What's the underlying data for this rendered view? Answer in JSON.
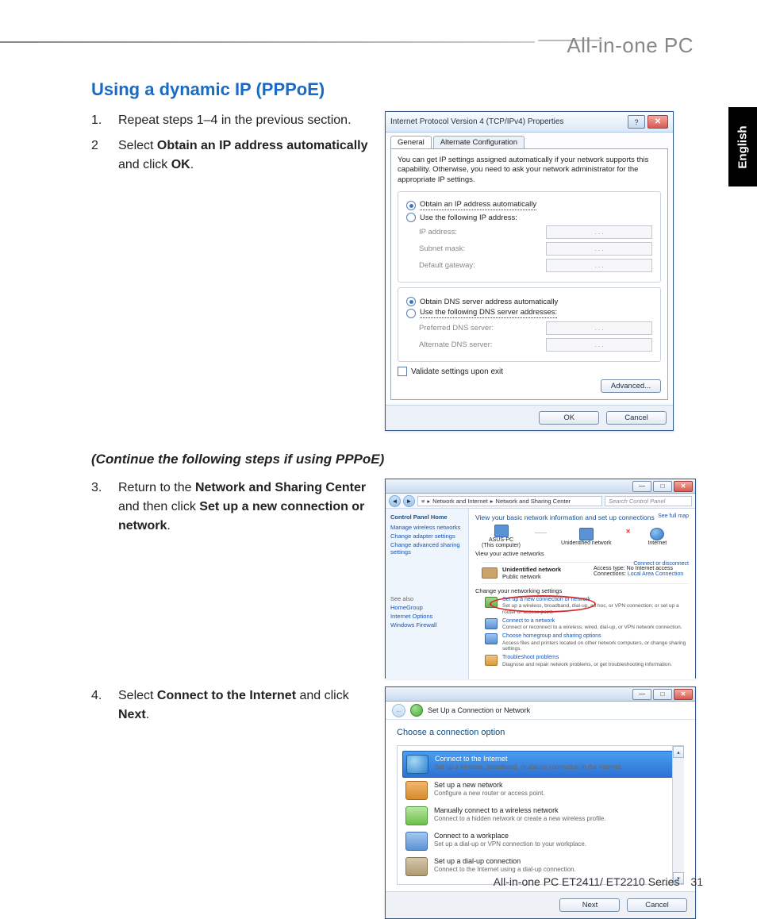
{
  "header": {
    "brand": "All-in-one PC",
    "langTab": "English"
  },
  "section": {
    "title": "Using a dynamic IP (PPPoE)"
  },
  "steps": {
    "s1_num": "1.",
    "s1_text": "Repeat steps 1–4 in the previous section.",
    "s2_num": "2",
    "s2_pre": "Select ",
    "s2_b": "Obtain an IP address automatically",
    "s2_mid": " and click ",
    "s2_b2": "OK",
    "s2_post": ".",
    "cont": "(Continue the following steps if using PPPoE)",
    "s3_num": "3.",
    "s3_pre": "Return to the ",
    "s3_b1": "Network and Sharing Center",
    "s3_mid": " and then click ",
    "s3_b2": "Set up a new connection or network",
    "s3_post": ".",
    "s4_num": "4.",
    "s4_pre": "Select ",
    "s4_b1": "Connect to the Internet",
    "s4_mid": " and click ",
    "s4_b2": "Next",
    "s4_post": "."
  },
  "dlg1": {
    "title": "Internet Protocol Version 4 (TCP/IPv4) Properties",
    "help": "?",
    "close": "✕",
    "tab1": "General",
    "tab2": "Alternate Configuration",
    "intro": "You can get IP settings assigned automatically if your network supports this capability. Otherwise, you need to ask your network administrator for the appropriate IP settings.",
    "r1": "Obtain an IP address automatically",
    "r2": "Use the following IP address:",
    "f1": "IP address:",
    "f2": "Subnet mask:",
    "f3": "Default gateway:",
    "r3": "Obtain DNS server address automatically",
    "r4": "Use the following DNS server addresses:",
    "f4": "Preferred DNS server:",
    "f5": "Alternate DNS server:",
    "chk": "Validate settings upon exit",
    "adv": "Advanced...",
    "ok": "OK",
    "cancel": "Cancel",
    "dots": ".   .   ."
  },
  "dlg2": {
    "bc1": "Network and Internet",
    "bc2": "Network and Sharing Center",
    "bcsep": "▸",
    "search": "Search Control Panel",
    "side_h": "Control Panel Home",
    "side1": "Manage wireless networks",
    "side2": "Change adapter settings",
    "side3": "Change advanced sharing settings",
    "seealso": "See also",
    "sa1": "HomeGroup",
    "sa2": "Internet Options",
    "sa3": "Windows Firewall",
    "hl": "View your basic network information and set up connections",
    "fullmap": "See full map",
    "n1": "ASUS-PC",
    "n1b": "(This computer)",
    "n2": "Unidentified network",
    "n3": "Internet",
    "view": "View your active networks",
    "cd": "Connect or disconnect",
    "un": "Unidentified network",
    "pub": "Public network",
    "at": "Access type:",
    "atv": "No Internet access",
    "cn": "Connections:",
    "cnv": "Local Area Connection",
    "chg": "Change your networking settings",
    "o1": "Set up a new connection or network",
    "o1d": "Set up a wireless, broadband, dial-up, ad hoc, or VPN connection; or set up a router or access point.",
    "o2": "Connect to a network",
    "o2d": "Connect or reconnect to a wireless, wired, dial-up, or VPN network connection.",
    "o3": "Choose homegroup and sharing options",
    "o3d": "Access files and printers located on other network computers, or change sharing settings.",
    "o4": "Troubleshoot problems",
    "o4d": "Diagnose and repair network problems, or get troubleshooting information."
  },
  "dlg3": {
    "title": "Set Up a Connection or Network",
    "prompt": "Choose a connection option",
    "i1": "Connect to the Internet",
    "i1d": "Set up a wireless, broadband, or dial-up connection to the Internet.",
    "i2": "Set up a new network",
    "i2d": "Configure a new router or access point.",
    "i3": "Manually connect to a wireless network",
    "i3d": "Connect to a hidden network or create a new wireless profile.",
    "i4": "Connect to a workplace",
    "i4d": "Set up a dial-up or VPN connection to your workplace.",
    "i5": "Set up a dial-up connection",
    "i5d": "Connect to the Internet using a dial-up connection.",
    "next": "Next",
    "cancel": "Cancel",
    "up": "▴",
    "down": "▾",
    "back": "←"
  },
  "footer": {
    "text": "All-in-one PC ET2411/ ET2210 Series",
    "page": "31"
  }
}
